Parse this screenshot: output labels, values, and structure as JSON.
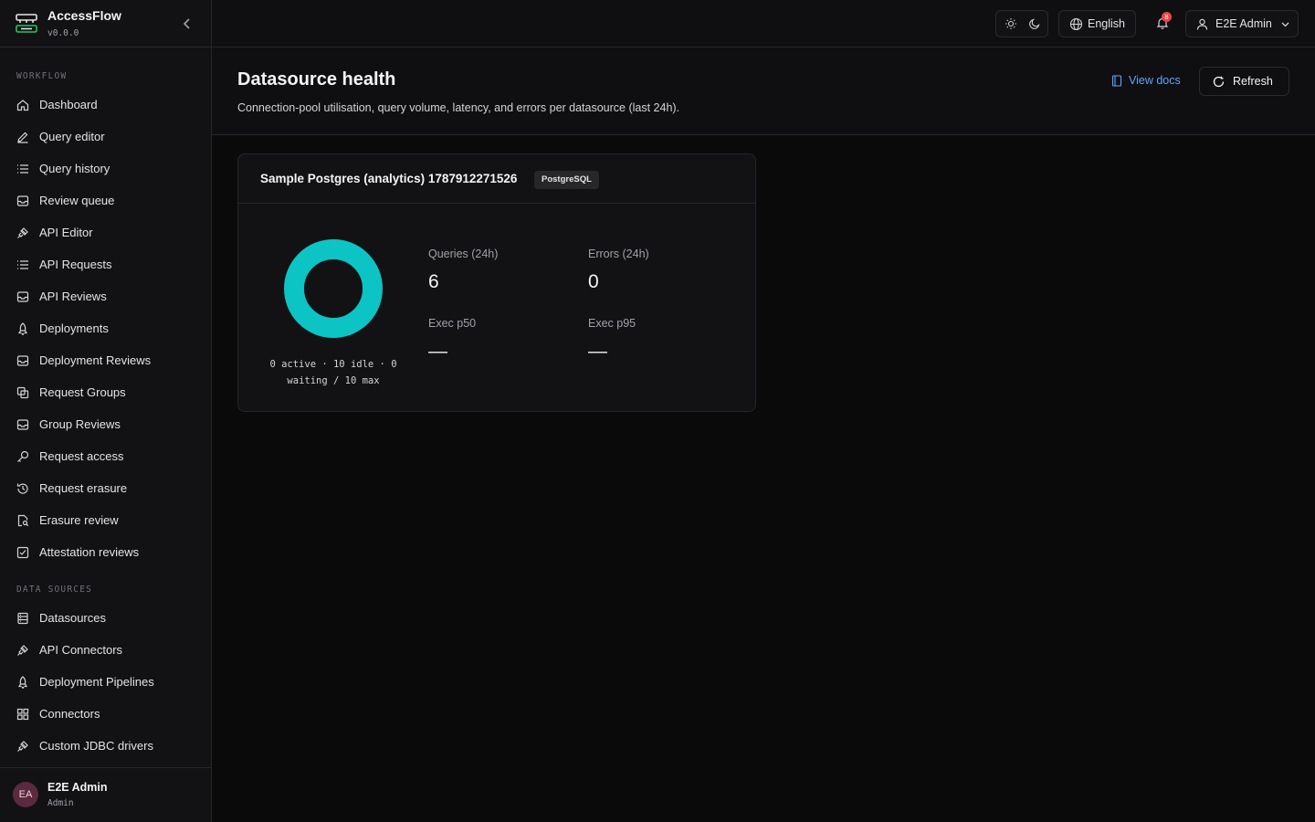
{
  "app": {
    "name": "AccessFlow",
    "version": "v0.0.0"
  },
  "sidebar": {
    "sections": [
      {
        "label": "WORKFLOW",
        "items": [
          {
            "label": "Dashboard",
            "icon": "home-icon"
          },
          {
            "label": "Query editor",
            "icon": "pencil-icon"
          },
          {
            "label": "Query history",
            "icon": "list-icon"
          },
          {
            "label": "Review queue",
            "icon": "inbox-icon"
          },
          {
            "label": "API Editor",
            "icon": "plug-icon"
          },
          {
            "label": "API Requests",
            "icon": "list-icon"
          },
          {
            "label": "API Reviews",
            "icon": "inbox-icon"
          },
          {
            "label": "Deployments",
            "icon": "rocket-icon"
          },
          {
            "label": "Deployment Reviews",
            "icon": "inbox-icon"
          },
          {
            "label": "Request Groups",
            "icon": "copy-icon"
          },
          {
            "label": "Group Reviews",
            "icon": "inbox-icon"
          },
          {
            "label": "Request access",
            "icon": "key-icon"
          },
          {
            "label": "Request erasure",
            "icon": "history-icon"
          },
          {
            "label": "Erasure review",
            "icon": "file-search-icon"
          },
          {
            "label": "Attestation reviews",
            "icon": "check-square-icon"
          }
        ]
      },
      {
        "label": "DATA SOURCES",
        "items": [
          {
            "label": "Datasources",
            "icon": "database-icon"
          },
          {
            "label": "API Connectors",
            "icon": "plug-icon"
          },
          {
            "label": "Deployment Pipelines",
            "icon": "rocket-icon"
          },
          {
            "label": "Connectors",
            "icon": "grid-icon"
          },
          {
            "label": "Custom JDBC drivers",
            "icon": "plug-icon"
          }
        ]
      }
    ],
    "user": {
      "initials": "EA",
      "name": "E2E Admin",
      "role": "Admin"
    }
  },
  "topbar": {
    "language": "English",
    "notifications_count": "8",
    "user_menu_label": "E2E Admin"
  },
  "page": {
    "title": "Datasource health",
    "subtitle": "Connection-pool utilisation, query volume, latency, and errors per datasource (last 24h).",
    "docs_label": "View docs",
    "refresh_label": "Refresh"
  },
  "datasource_card": {
    "name": "Sample Postgres (analytics) 1787912271526",
    "type": "PostgreSQL",
    "pool": {
      "active": 0,
      "idle": 10,
      "waiting": 0,
      "max": 10,
      "line1": "0 active · 10 idle · 0",
      "line2": "waiting / 10 max"
    },
    "stats": {
      "queries_label": "Queries (24h)",
      "queries_value": "6",
      "errors_label": "Errors (24h)",
      "errors_value": "0",
      "p50_label": "Exec p50",
      "p50_value": "—",
      "p95_label": "Exec p95",
      "p95_value": "—"
    },
    "colors": {
      "idle": "#0cc4c4",
      "active": "#3b82f6"
    }
  }
}
